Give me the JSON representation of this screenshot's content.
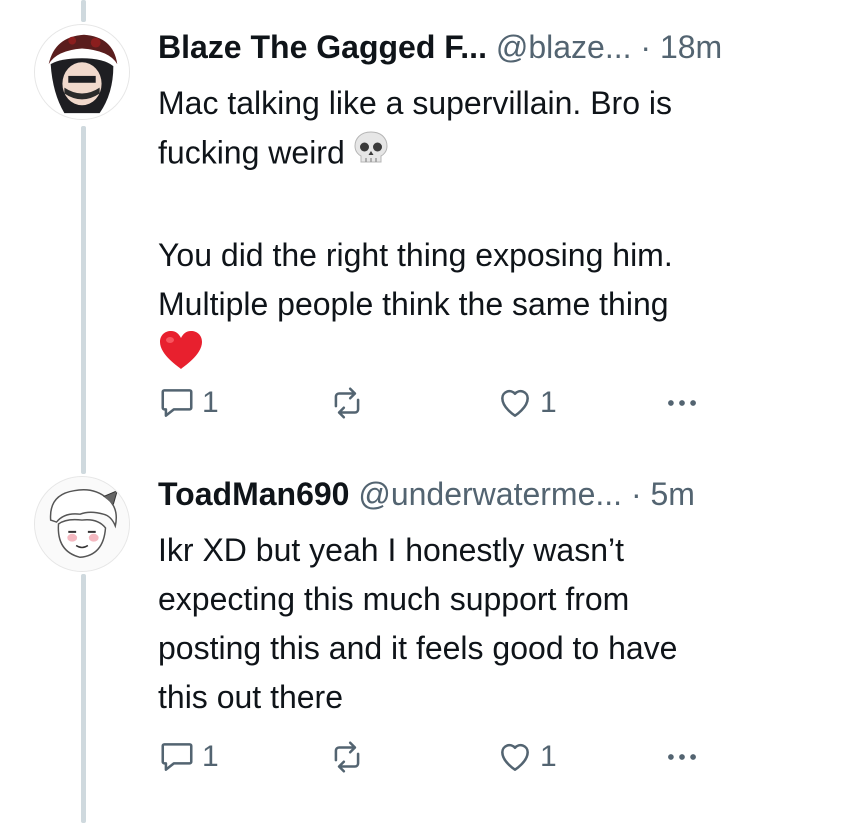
{
  "replies": [
    {
      "display_name": "Blaze The Gagged F...",
      "handle": "@blaze...",
      "time": "· 18m",
      "lines": [
        "Mac talking like a supervillain. Bro is",
        "fucking weird",
        "",
        "You did the right thing exposing him.",
        "Multiple people think the same thing"
      ],
      "emojis": [
        "skull-emoji",
        "red-heart-emoji"
      ],
      "reply_count": "1",
      "like_count": "1"
    },
    {
      "display_name": "ToadMan690",
      "handle": "@underwaterme...",
      "time": "· 5m",
      "lines": [
        "Ikr XD but yeah I honestly wasn’t",
        "expecting this much support from",
        "posting this and it feels good to have",
        "this out there"
      ],
      "reply_count": "1",
      "like_count": "1"
    }
  ],
  "icons": {
    "reply": "speech-bubble-icon",
    "repost": "repost-arrows-icon",
    "like": "heart-outline-icon",
    "more": "more-dots-icon"
  },
  "colors": {
    "text": "#0f1419",
    "secondary": "#536471",
    "thread_line": "#cfd9de",
    "heart": "#e0245e"
  }
}
